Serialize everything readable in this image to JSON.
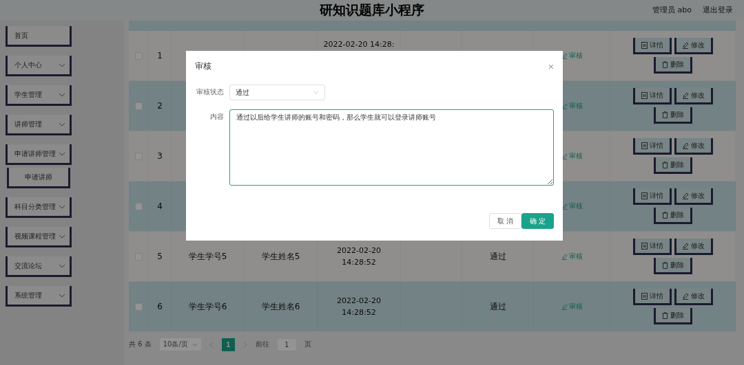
{
  "header": {
    "title": "研知识题库小程序",
    "user": "管理员 abo",
    "logout": "退出登录"
  },
  "sidebar": {
    "items": [
      {
        "label": "首页",
        "has_arrow": false
      },
      {
        "label": "个人中心",
        "has_arrow": true
      },
      {
        "label": "学生管理",
        "has_arrow": true
      },
      {
        "label": "讲师管理",
        "has_arrow": true
      },
      {
        "label": "申请讲师管理",
        "has_arrow": true,
        "children": [
          {
            "label": "申请讲师"
          }
        ]
      },
      {
        "label": "科目分类管理",
        "has_arrow": true
      },
      {
        "label": "视频课程管理",
        "has_arrow": true
      },
      {
        "label": "交流论坛",
        "has_arrow": true
      },
      {
        "label": "系统管理",
        "has_arrow": true
      }
    ]
  },
  "table": {
    "rows": [
      {
        "index": "1",
        "checked": false,
        "time": "2022-02-20 14:28:",
        "review": "审核",
        "actions": [
          "详情",
          "修改",
          "删除"
        ]
      },
      {
        "index": "2",
        "checked": false,
        "review": "审核",
        "actions": [
          "详情",
          "修改",
          "删除"
        ]
      },
      {
        "index": "3",
        "checked": false,
        "review": "审核",
        "actions": [
          "详情",
          "修改",
          "删除"
        ]
      },
      {
        "index": "4",
        "checked": false,
        "review": "审核",
        "actions": [
          "详情",
          "修改",
          "删除"
        ]
      },
      {
        "index": "5",
        "checked": false,
        "student_no": "学生学号5",
        "student_name": "学生姓名5",
        "time": "2022-02-20 14:28:52",
        "status": "通过",
        "review": "审核",
        "actions": [
          "详情",
          "修改",
          "删除"
        ]
      },
      {
        "index": "6",
        "checked": false,
        "student_no": "学生学号6",
        "student_name": "学生姓名6",
        "time": "2022-02-20 14:28:52",
        "status": "通过",
        "review": "审核",
        "actions": [
          "详情",
          "修改",
          "删除"
        ]
      }
    ]
  },
  "pagination": {
    "total": "共 6 条",
    "page_size": "10条/页",
    "pages": [
      {
        "label": "1",
        "selected": true
      }
    ],
    "goto_label": "前往",
    "goto_value": "1",
    "goto_suffix": "页"
  },
  "modal": {
    "title": "审核",
    "close": "×",
    "status_label": "审核状态",
    "status_value": "通过",
    "content_label": "内容",
    "content": "通过以后给学生讲师的账号和密码，那么学生就可以登录讲师账号",
    "cancel": "取 消",
    "confirm": "确 定"
  }
}
